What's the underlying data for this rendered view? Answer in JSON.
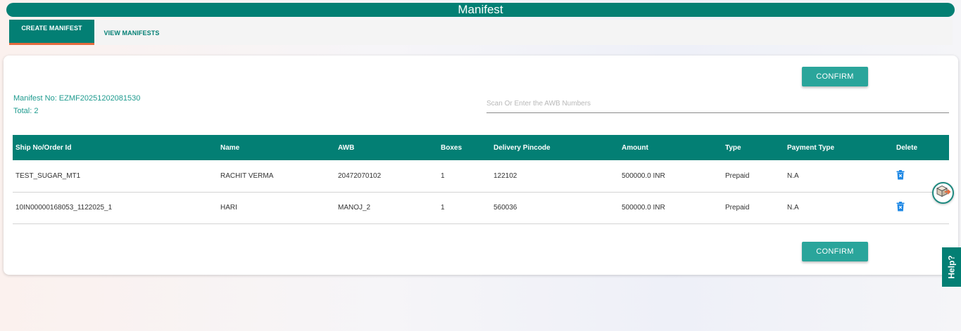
{
  "page": {
    "title": "Manifest"
  },
  "tabs": [
    {
      "label": "CREATE MANIFEST",
      "active": true
    },
    {
      "label": "VIEW MANIFESTS",
      "active": false
    }
  ],
  "manifest": {
    "number_text": "Manifest No: EZMF20251202081530",
    "total_text": "Total: 2"
  },
  "buttons": {
    "confirm_top": "CONFIRM",
    "confirm_bottom": "CONFIRM"
  },
  "awb_input": {
    "placeholder": "Scan Or Enter the AWB Numbers",
    "value": ""
  },
  "table": {
    "headers": [
      "Ship No/Order Id",
      "Name",
      "AWB",
      "Boxes",
      "Delivery Pincode",
      "Amount",
      "Type",
      "Payment Type",
      "Delete"
    ],
    "rows": [
      {
        "ship_no": "TEST_SUGAR_MT1",
        "name": "RACHIT VERMA",
        "awb": "20472070102",
        "boxes": "1",
        "pincode": "122102",
        "amount": "500000.0 INR",
        "type": "Prepaid",
        "payment_type": "N.A",
        "delete_icon": "trash-icon"
      },
      {
        "ship_no": "10IN00000168053_1122025_1",
        "name": "HARI",
        "awb": "MANOJ_2",
        "boxes": "1",
        "pincode": "560036",
        "amount": "500000.0 INR",
        "type": "Prepaid",
        "payment_type": "N.A",
        "delete_icon": "trash-icon"
      }
    ]
  },
  "help": {
    "label": "Help?"
  },
  "floating_button": {
    "icon": "package-exit-icon"
  },
  "colors": {
    "primary": "#037f74",
    "button": "#2aa59b",
    "accent": "#e46a3d",
    "delete_icon": "#1e88e5"
  }
}
